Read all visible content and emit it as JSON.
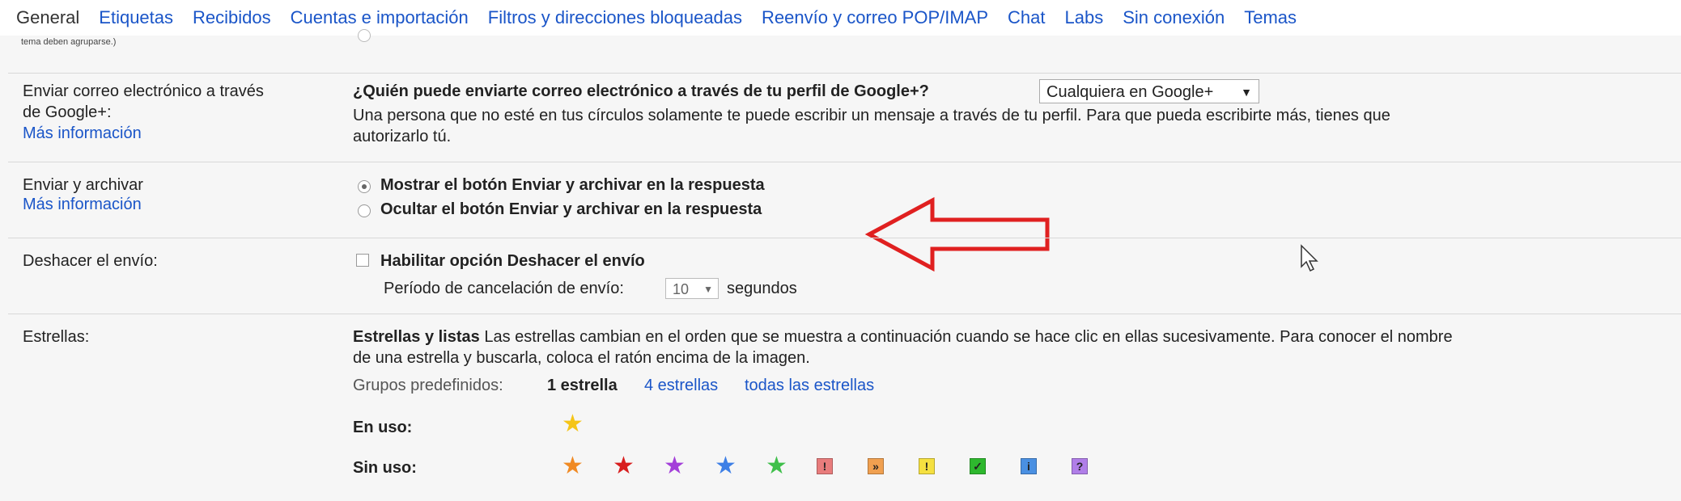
{
  "tabs": [
    {
      "label": "General",
      "active": true
    },
    {
      "label": "Etiquetas"
    },
    {
      "label": "Recibidos"
    },
    {
      "label": "Cuentas e importación"
    },
    {
      "label": "Filtros y direcciones bloqueadas"
    },
    {
      "label": "Reenvío y correo POP/IMAP"
    },
    {
      "label": "Chat"
    },
    {
      "label": "Labs"
    },
    {
      "label": "Sin conexión"
    },
    {
      "label": "Temas"
    }
  ],
  "top_cut_text": "tema deben agruparse.)",
  "google_plus": {
    "label_line1": "Enviar correo electrónico a través",
    "label_line2": "de Google+:",
    "more": "Más información",
    "question": "¿Quién puede enviarte correo electrónico a través de tu perfil de Google+?",
    "select_value": "Cualquiera en Google+",
    "desc_line1": "Una persona que no esté en tus círculos solamente te puede escribir un mensaje a través de tu perfil. Para que pueda escribirte más, tienes que",
    "desc_line2": "autorizarlo tú."
  },
  "send_archive": {
    "label": "Enviar y archivar",
    "more": "Más información",
    "option_show": "Mostrar el botón Enviar y archivar en la respuesta",
    "option_hide": "Ocultar el botón Enviar y archivar en la respuesta",
    "selected": "show"
  },
  "undo_send": {
    "label": "Deshacer el envío:",
    "checkbox_label": "Habilitar opción Deshacer el envío",
    "checked": false,
    "period_label": "Período de cancelación de envío:",
    "period_value": "10",
    "period_unit": "segundos"
  },
  "stars": {
    "label": "Estrellas:",
    "heading": "Estrellas y listas",
    "desc_line1": "Las estrellas cambian en el orden que se muestra a continuación cuando se hace clic en ellas sucesivamente. Para conocer el nombre",
    "desc_line2": "de una estrella y buscarla, coloca el ratón encima de la imagen.",
    "presets_label": "Grupos predefinidos:",
    "preset_one": "1 estrella",
    "preset_four": "4 estrellas",
    "preset_all": "todas las estrellas",
    "in_use_label": "En uso:",
    "unused_label": "Sin uso:",
    "in_use": [
      {
        "icon": "yellow-star-icon",
        "color": "#f5c518"
      }
    ],
    "unused": [
      {
        "icon": "orange-star-icon",
        "color": "#f08a24"
      },
      {
        "icon": "red-star-icon",
        "color": "#d81e1e"
      },
      {
        "icon": "purple-star-icon",
        "color": "#a33fd9"
      },
      {
        "icon": "blue-star-icon",
        "color": "#3d7fe6"
      },
      {
        "icon": "green-star-icon",
        "color": "#3fbf4a"
      },
      {
        "icon": "red-bang-icon",
        "color": "#e87c7c",
        "glyph": "!"
      },
      {
        "icon": "orange-guillemet-icon",
        "color": "#f0a050",
        "glyph": "»"
      },
      {
        "icon": "yellow-bang-icon",
        "color": "#f5e040",
        "glyph": "!"
      },
      {
        "icon": "green-check-icon",
        "color": "#2eb82e",
        "glyph": "✓"
      },
      {
        "icon": "blue-info-icon",
        "color": "#4a90e2",
        "glyph": "i"
      },
      {
        "icon": "purple-question-icon",
        "color": "#b07ee8",
        "glyph": "?"
      }
    ]
  },
  "annotation_color": "#e02020"
}
